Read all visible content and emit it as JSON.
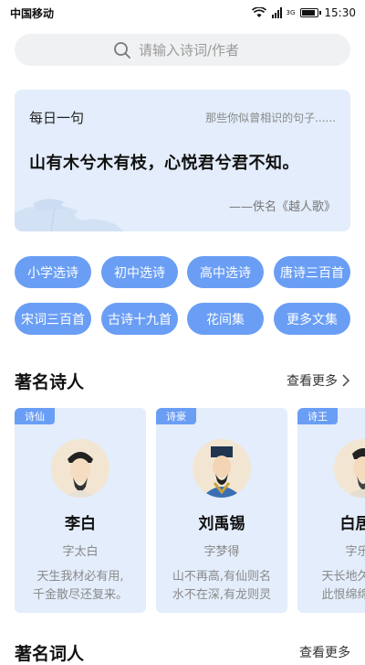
{
  "status": {
    "carrier": "中国移动",
    "network": "3G",
    "time": "15:30"
  },
  "search": {
    "placeholder": "请输入诗词/作者"
  },
  "daily": {
    "label": "每日一句",
    "subtitle": "那些你似曾相识的句子......",
    "quote": "山有木兮木有枝，心悦君兮君不知。",
    "source": "——佚名《越人歌》"
  },
  "tags": [
    "小学选诗",
    "初中选诗",
    "高中选诗",
    "唐诗三百首",
    "宋词三百首",
    "古诗十九首",
    "花间集",
    "更多文集"
  ],
  "poets_section": {
    "title": "著名诗人",
    "more": "查看更多"
  },
  "poets": [
    {
      "badge": "诗仙",
      "name": "李白",
      "courtesy": "字太白",
      "line1": "天生我材必有用,",
      "line2": "千金散尽还复来。"
    },
    {
      "badge": "诗豪",
      "name": "刘禹锡",
      "courtesy": "字梦得",
      "line1": "山不再高,有仙则名",
      "line2": "水不在深,有龙则灵"
    },
    {
      "badge": "诗王",
      "name": "白居易",
      "courtesy": "字乐天",
      "line1": "天长地久有时尽",
      "line2": "此恨绵绵无绝期"
    }
  ],
  "next_section": {
    "title": "著名词人",
    "more": "查看更多"
  },
  "colors": {
    "accent": "#6a9ef5",
    "card_bg": "#e3edfb"
  }
}
